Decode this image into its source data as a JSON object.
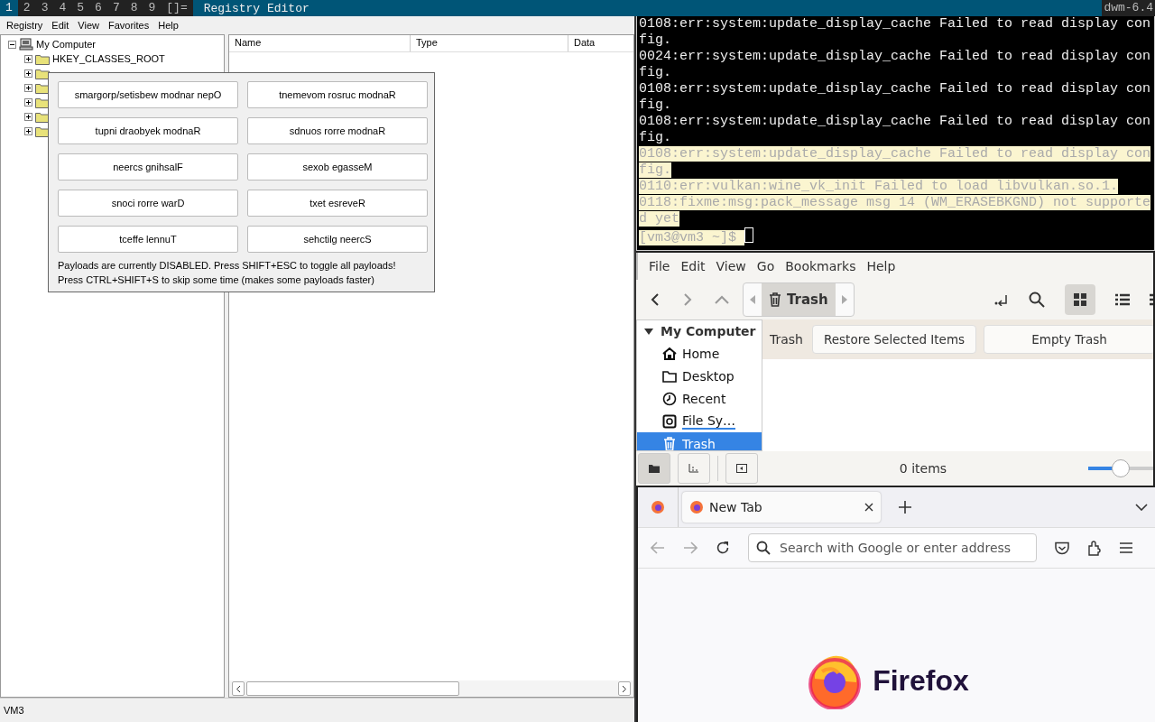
{
  "bar": {
    "tags": [
      {
        "label": "1",
        "selected": true
      },
      {
        "label": "2",
        "selected": false
      },
      {
        "label": "3",
        "selected": false
      },
      {
        "label": "4",
        "selected": false
      },
      {
        "label": "5",
        "selected": false
      },
      {
        "label": "6",
        "selected": false
      },
      {
        "label": "7",
        "selected": false
      },
      {
        "label": "8",
        "selected": false
      },
      {
        "label": "9",
        "selected": false
      }
    ],
    "layout": "[]=",
    "title": "Registry Editor",
    "status": "dwm-6.4"
  },
  "registry": {
    "menu": [
      "Registry",
      "Edit",
      "View",
      "Favorites",
      "Help"
    ],
    "tree": {
      "label": "My Computer",
      "expanded": true,
      "children": [
        {
          "label": "HKEY_CLASSES_ROOT",
          "expanded": false
        },
        {
          "expanded": false
        },
        {
          "expanded": false
        },
        {
          "expanded": false
        },
        {
          "expanded": false
        },
        {
          "expanded": false
        }
      ]
    },
    "columns": [
      "Name",
      "Type",
      "Data"
    ],
    "status_bar": "VM3"
  },
  "dialog": {
    "buttons": [
      "smargorp/setisbew modnar nepO",
      "tnemevom rosruc modnaR",
      "tupni draobyek modnaR",
      "sdnuos rorre modnaR",
      "neercs gnihsalF",
      "sexob egasseM",
      "snoci rorre warD",
      "txet esreveR",
      "tceffe lennuT",
      "sehctilg neercS"
    ],
    "notes": [
      "Payloads are currently DISABLED. Press SHIFT+ESC to toggle all payloads!",
      "Press CTRL+SHIFT+S to skip some time (makes some payloads faster)"
    ]
  },
  "terminal": {
    "lines": [
      {
        "text": "0108:err:system:update_display_cache Failed to read display con",
        "selected": false
      },
      {
        "text": "fig.",
        "selected": false
      },
      {
        "text": "0024:err:system:update_display_cache Failed to read display con",
        "selected": false
      },
      {
        "text": "fig.",
        "selected": false
      },
      {
        "text": "0108:err:system:update_display_cache Failed to read display con",
        "selected": false
      },
      {
        "text": "fig.",
        "selected": false
      },
      {
        "text": "0108:err:system:update_display_cache Failed to read display con",
        "selected": false
      },
      {
        "text": "fig.",
        "selected": false
      },
      {
        "text": "0108:err:system:update_display_cache Failed to read display con",
        "selected": true
      },
      {
        "text": "fig.",
        "selected": true
      },
      {
        "text": "0110:err:vulkan:wine_vk_init Failed to load libvulkan.so.1.",
        "selected": true
      },
      {
        "text": "0118:fixme:msg:pack_message msg 14 (WM_ERASEBKGND) not supporte",
        "selected": true
      },
      {
        "text": "d yet",
        "selected": true
      },
      {
        "text": "[vm3@vm3 ~]$ ",
        "selected": true
      }
    ]
  },
  "files": {
    "menu": [
      "File",
      "Edit",
      "View",
      "Go",
      "Bookmarks",
      "Help"
    ],
    "path": "Trash",
    "sidebar": {
      "heading": "My Computer",
      "expanded": true,
      "items": [
        {
          "label": "Home",
          "kind": "home",
          "selected": false
        },
        {
          "label": "Desktop",
          "kind": "folder",
          "selected": false
        },
        {
          "label": "Recent",
          "kind": "clock",
          "selected": false
        },
        {
          "label": "File Sy…",
          "kind": "drive",
          "selected": false
        },
        {
          "label": "Trash",
          "kind": "trash",
          "selected": true
        }
      ]
    },
    "location_label": "Trash",
    "actions": [
      "Restore Selected Items",
      "Empty Trash"
    ],
    "status": "0 items",
    "zoom": {
      "level": 0.5
    }
  },
  "browser": {
    "tabs": [
      {
        "label": "New Tab",
        "selected": true
      }
    ],
    "address": {
      "placeholder": "Search with Google or enter address"
    },
    "wordmark": "Firefox"
  }
}
